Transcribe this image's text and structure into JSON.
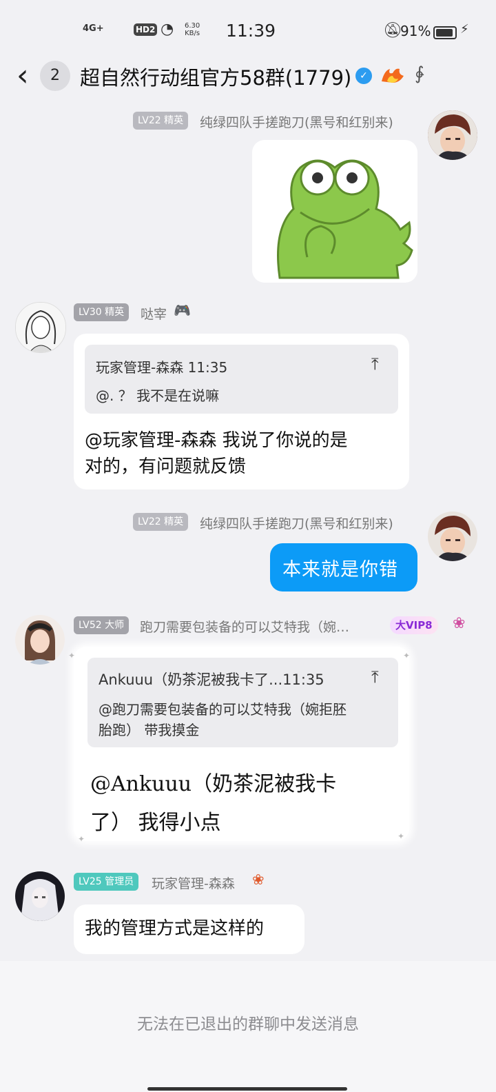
{
  "status_bar": {
    "network": "4G+",
    "hd": "HD2",
    "speed_top": "6.30",
    "speed_bottom": "KB/s",
    "time": "11:39",
    "battery": "91%"
  },
  "header": {
    "back_icon": "chevron-left-icon",
    "unread_count": "2",
    "title": "超自然行动组官方58群(1779)",
    "verified_icon": "verified-badge-icon",
    "fire_icon": "fire-badge-icon",
    "ear_icon": "ear-icon"
  },
  "messages": [
    {
      "level": "LV22 精英",
      "sender": "纯绿四队手搓跑刀(黑号和红别来)",
      "type": "sticker",
      "sticker": "frog-sticker"
    },
    {
      "level": "LV30 精英",
      "sender": "哒宰",
      "quote_header": "玩家管理-森森 11:35",
      "quote_text": "@. ？ 我不是在说嘛",
      "text_line1": "@玩家管理-森森 我说了你说的是",
      "text_line2": "对的，有问题就反馈"
    },
    {
      "level": "LV22 精英",
      "sender": "纯绿四队手搓跑刀(黑号和红别来)",
      "text": "本来就是你错"
    },
    {
      "level": "LV52 大师",
      "sender": "跑刀需要包装备的可以艾特我（婉…",
      "vip": "大VIP8",
      "quote_header": "Ankuuu（奶茶泥被我卡了...11:35",
      "quote_line1": "@跑刀需要包装备的可以艾特我（婉拒胚",
      "quote_line2": "胎跑） 带我摸金",
      "text_line1": "@Ankuuu（奶茶泥被我卡",
      "text_line2": "了）  我得小点"
    },
    {
      "level": "LV25 管理员",
      "sender": "玩家管理-森森",
      "text": "我的管理方式是这样的"
    }
  ],
  "bottom_notice": "无法在已退出的群聊中发送消息",
  "colors": {
    "accent_blue": "#0c9bf7",
    "background": "#f1f1f4",
    "admin_green": "#4fc8bd"
  }
}
